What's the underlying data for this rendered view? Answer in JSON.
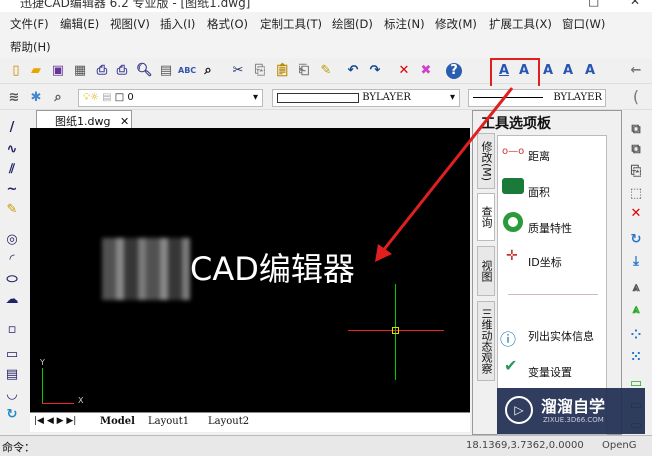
{
  "title": "迅捷CAD编辑器 6.2 专业版 - [图纸1.dwg]",
  "menu": [
    "文件(F)",
    "编辑(E)",
    "视图(V)",
    "插入(I)",
    "格式(O)",
    "定制工具(T)",
    "绘图(D)",
    "标注(N)",
    "修改(M)",
    "扩展工具(X)",
    "窗口(W)",
    "帮助(H)"
  ],
  "layer": {
    "value": "0",
    "color_value": "BYLAYER",
    "linetype_value": "BYLAYER"
  },
  "doc_tab": "图纸1.dwg",
  "doc_tab_close": "✕",
  "canvas_text": "CAD编辑器",
  "ucs": {
    "x": "X",
    "y": "Y"
  },
  "layout_tabs": [
    "Model",
    "Layout1",
    "Layout2"
  ],
  "palette": {
    "title": "工具选项板",
    "tabs": [
      "修改(M)",
      "查询",
      "视图",
      "三维动态观察"
    ],
    "items": [
      "距离",
      "面积",
      "质量特性",
      "ID坐标",
      "列出实体信息",
      "变量设置"
    ]
  },
  "status": {
    "command_label": "命令：",
    "coords": "18.1369,3.7362,0.0000",
    "renderer": "OpenG"
  },
  "watermark": {
    "name": "溜溜自学",
    "url": "ZIXUE.3D66.COM"
  },
  "colors": {
    "highlight": "#e02020",
    "canvas": "#000000"
  }
}
